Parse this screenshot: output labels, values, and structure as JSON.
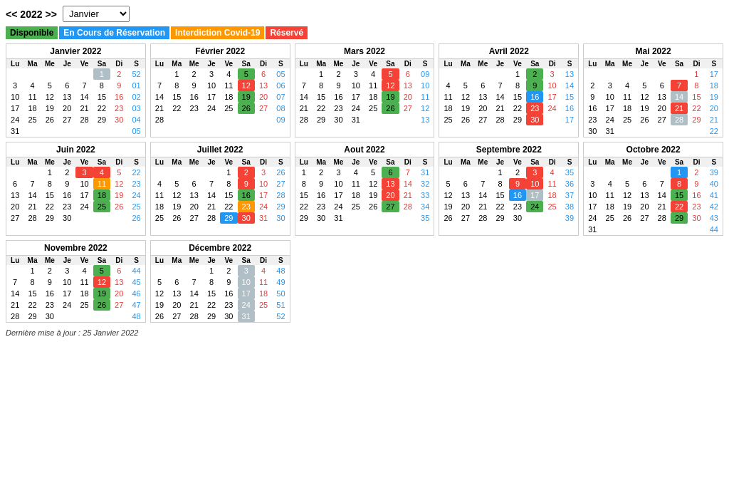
{
  "header": {
    "year": "2022",
    "nav_prev": "<< 2022",
    "nav_next": ">>",
    "dropdown_value": "Janvier",
    "dropdown_options": [
      "Janvier",
      "Février",
      "Mars",
      "Avril",
      "Mai",
      "Juin",
      "Juillet",
      "Août",
      "Septembre",
      "Octobre",
      "Novembre",
      "Décembre"
    ]
  },
  "legend": [
    {
      "label": "Disponible",
      "class": "disponible"
    },
    {
      "label": "En Cours de Réservation",
      "class": "en-cours"
    },
    {
      "label": "Interdiction Covid-19",
      "class": "interdiction"
    },
    {
      "label": "Réservé",
      "class": "reserve"
    }
  ],
  "footer": "Dernière mise à jour : 25 Janvier 2022",
  "months": [
    {
      "name": "Janvier 2022",
      "headers": [
        "Lu",
        "Ma",
        "Me",
        "Je",
        "Ve",
        "Sa",
        "Di",
        "S"
      ],
      "rows": [
        [
          "",
          "",
          "",
          "",
          "",
          "1",
          "2",
          "52"
        ],
        [
          "3",
          "4",
          "5",
          "6",
          "7",
          "8",
          "9",
          "01"
        ],
        [
          "10",
          "11",
          "12",
          "13",
          "14",
          "15",
          "16",
          "02"
        ],
        [
          "17",
          "18",
          "19",
          "20",
          "21",
          "22",
          "23",
          "03"
        ],
        [
          "24",
          "25",
          "26",
          "27",
          "28",
          "29",
          "30",
          "04"
        ],
        [
          "31",
          "",
          "",
          "",
          "",
          "",
          "",
          "05"
        ]
      ],
      "special": {
        "52": "week-num",
        "01": "week-num",
        "02": "week-num",
        "03": "week-num",
        "04": "week-num",
        "05": "week-num"
      },
      "cell_classes": {
        "1-5": "gray",
        "2-6": "sunday"
      }
    }
  ]
}
